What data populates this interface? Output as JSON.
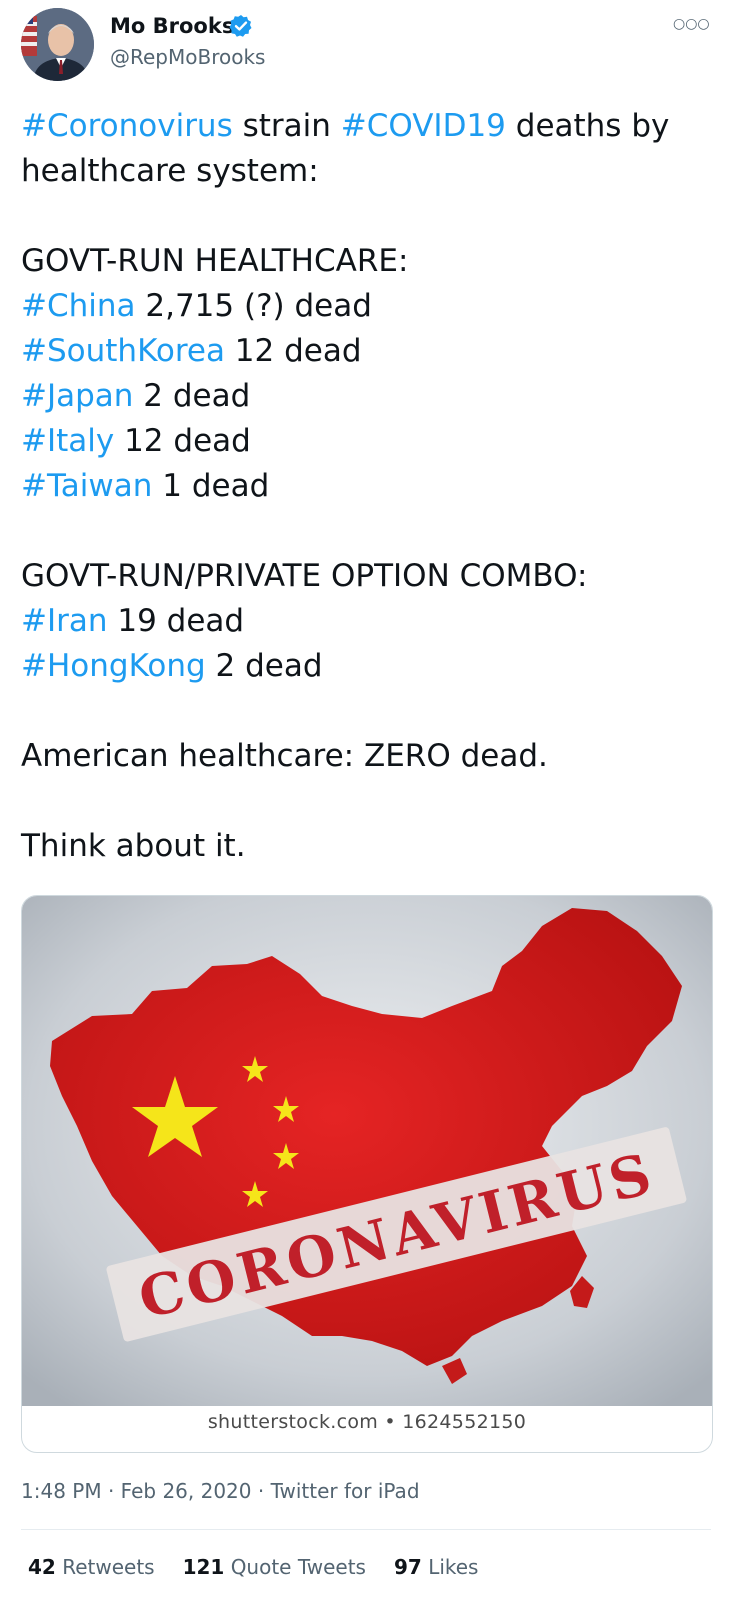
{
  "author": {
    "name": "Mo Brooks",
    "handle": "@RepMoBrooks"
  },
  "icons": {
    "verified": "verified-badge-icon",
    "more": "more-options-icon"
  },
  "tweet": {
    "lines": [
      [
        {
          "t": "#Coronovirus",
          "tag": true
        },
        {
          "t": " strain "
        },
        {
          "t": "#COVID19",
          "tag": true
        },
        {
          "t": " deaths by"
        }
      ],
      [
        {
          "t": "healthcare system:"
        }
      ],
      [],
      [
        {
          "t": "GOVT-RUN HEALTHCARE:"
        }
      ],
      [
        {
          "t": "#China",
          "tag": true
        },
        {
          "t": " 2,715 (?) dead"
        }
      ],
      [
        {
          "t": "#SouthKorea",
          "tag": true
        },
        {
          "t": " 12 dead"
        }
      ],
      [
        {
          "t": "#Japan",
          "tag": true
        },
        {
          "t": " 2 dead"
        }
      ],
      [
        {
          "t": "#Italy",
          "tag": true
        },
        {
          "t": " 12 dead"
        }
      ],
      [
        {
          "t": "#Taiwan",
          "tag": true
        },
        {
          "t": " 1 dead"
        }
      ],
      [],
      [
        {
          "t": "GOVT-RUN/PRIVATE OPTION COMBO:"
        }
      ],
      [
        {
          "t": "#Iran",
          "tag": true
        },
        {
          "t": " 19 dead"
        }
      ],
      [
        {
          "t": "#HongKong",
          "tag": true
        },
        {
          "t": " 2 dead"
        }
      ],
      [],
      [
        {
          "t": "American healthcare: ZERO dead."
        }
      ],
      [],
      [
        {
          "t": "Think about it."
        }
      ]
    ]
  },
  "media": {
    "stamp_text": "CORONAVIRUS",
    "caption": "shutterstock.com • 1624552150"
  },
  "meta": {
    "time": "1:48 PM",
    "date": "Feb 26, 2020",
    "source": "Twitter for iPad"
  },
  "stats": {
    "retweets": {
      "count": "42",
      "label": "Retweets"
    },
    "quotes": {
      "count": "121",
      "label": "Quote Tweets"
    },
    "likes": {
      "count": "97",
      "label": "Likes"
    }
  },
  "colors": {
    "link": "#1d9bf0",
    "flag_red": "#d41c1c",
    "star_yellow": "#f5e51a"
  }
}
